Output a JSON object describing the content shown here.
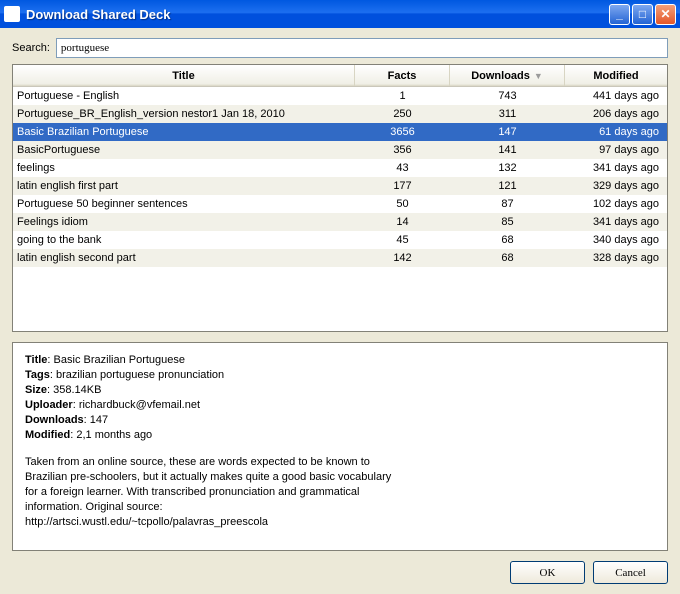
{
  "window": {
    "title": "Download Shared Deck"
  },
  "search": {
    "label": "Search:",
    "value": "portuguese"
  },
  "table": {
    "columns": {
      "title": "Title",
      "facts": "Facts",
      "downloads": "Downloads",
      "modified": "Modified"
    },
    "sort_indicator": "▼",
    "rows": [
      {
        "title": "Portuguese - English",
        "facts": "1",
        "downloads": "743",
        "modified": "441 days ago",
        "selected": false
      },
      {
        "title": "Portuguese_BR_English_version nestor1 Jan 18, 2010",
        "facts": "250",
        "downloads": "311",
        "modified": "206 days ago",
        "selected": false
      },
      {
        "title": "Basic Brazilian Portuguese",
        "facts": "3656",
        "downloads": "147",
        "modified": "61 days ago",
        "selected": true
      },
      {
        "title": "BasicPortuguese",
        "facts": "356",
        "downloads": "141",
        "modified": "97 days ago",
        "selected": false
      },
      {
        "title": "feelings",
        "facts": "43",
        "downloads": "132",
        "modified": "341 days ago",
        "selected": false
      },
      {
        "title": "latin english first part",
        "facts": "177",
        "downloads": "121",
        "modified": "329 days ago",
        "selected": false
      },
      {
        "title": "Portuguese 50 beginner sentences",
        "facts": "50",
        "downloads": "87",
        "modified": "102 days ago",
        "selected": false
      },
      {
        "title": "Feelings idiom",
        "facts": "14",
        "downloads": "85",
        "modified": "341 days ago",
        "selected": false
      },
      {
        "title": "going to the bank",
        "facts": "45",
        "downloads": "68",
        "modified": "340 days ago",
        "selected": false
      },
      {
        "title": "latin english second part",
        "facts": "142",
        "downloads": "68",
        "modified": "328 days ago",
        "selected": false
      }
    ]
  },
  "details": {
    "labels": {
      "title": "Title",
      "tags": "Tags",
      "size": "Size",
      "uploader": "Uploader",
      "downloads": "Downloads",
      "modified": "Modified"
    },
    "title": "Basic Brazilian Portuguese",
    "tags": "brazilian portuguese pronunciation",
    "size": "358.14KB",
    "uploader": "richardbuck@vfemail.net",
    "downloads": "147",
    "modified": "2,1 months ago",
    "description": "Taken from an online source, these are words expected to be known to Brazilian pre-schoolers, but it actually makes quite a good basic vocabulary for a foreign learner. With transcribed pronunciation and grammatical information. Original source: http://artsci.wustl.edu/~tcpollo/palavras_preescola"
  },
  "buttons": {
    "ok": "OK",
    "cancel": "Cancel"
  }
}
